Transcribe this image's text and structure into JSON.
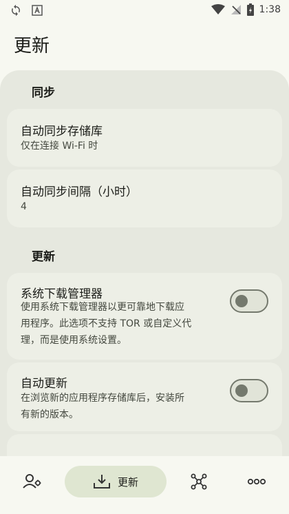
{
  "status_bar": {
    "time": "1:38"
  },
  "page": {
    "title": "更新"
  },
  "sync_section": {
    "header": "同步",
    "auto_sync": {
      "title": "自动同步存储库",
      "subtitle": "仅在连接 Wi-Fi 时"
    },
    "interval": {
      "title": "自动同步间隔（小时）",
      "value": "4"
    }
  },
  "update_section": {
    "header": "更新",
    "download_manager": {
      "title": "系统下载管理器",
      "subtitle_lines": [
        "使用系统下载管理器以更可靠地下载应",
        "用程序。此选项不支持 TOR 或自定义代",
        "理，而是使用系统设置。"
      ],
      "enabled": false
    },
    "auto_update": {
      "title": "自动更新",
      "subtitle_lines": [
        "在浏览新的应用程序存储库后，安装所",
        "有新的版本。"
      ],
      "enabled": false
    }
  },
  "bottom_nav": {
    "active_label": "更新",
    "items": [
      "profile-settings",
      "updates",
      "repositories-graph",
      "more"
    ]
  },
  "colors": {
    "accent": "#dfe6d1",
    "panel": "#e6e8df",
    "card": "#edefe6",
    "outline": "#74796d"
  }
}
